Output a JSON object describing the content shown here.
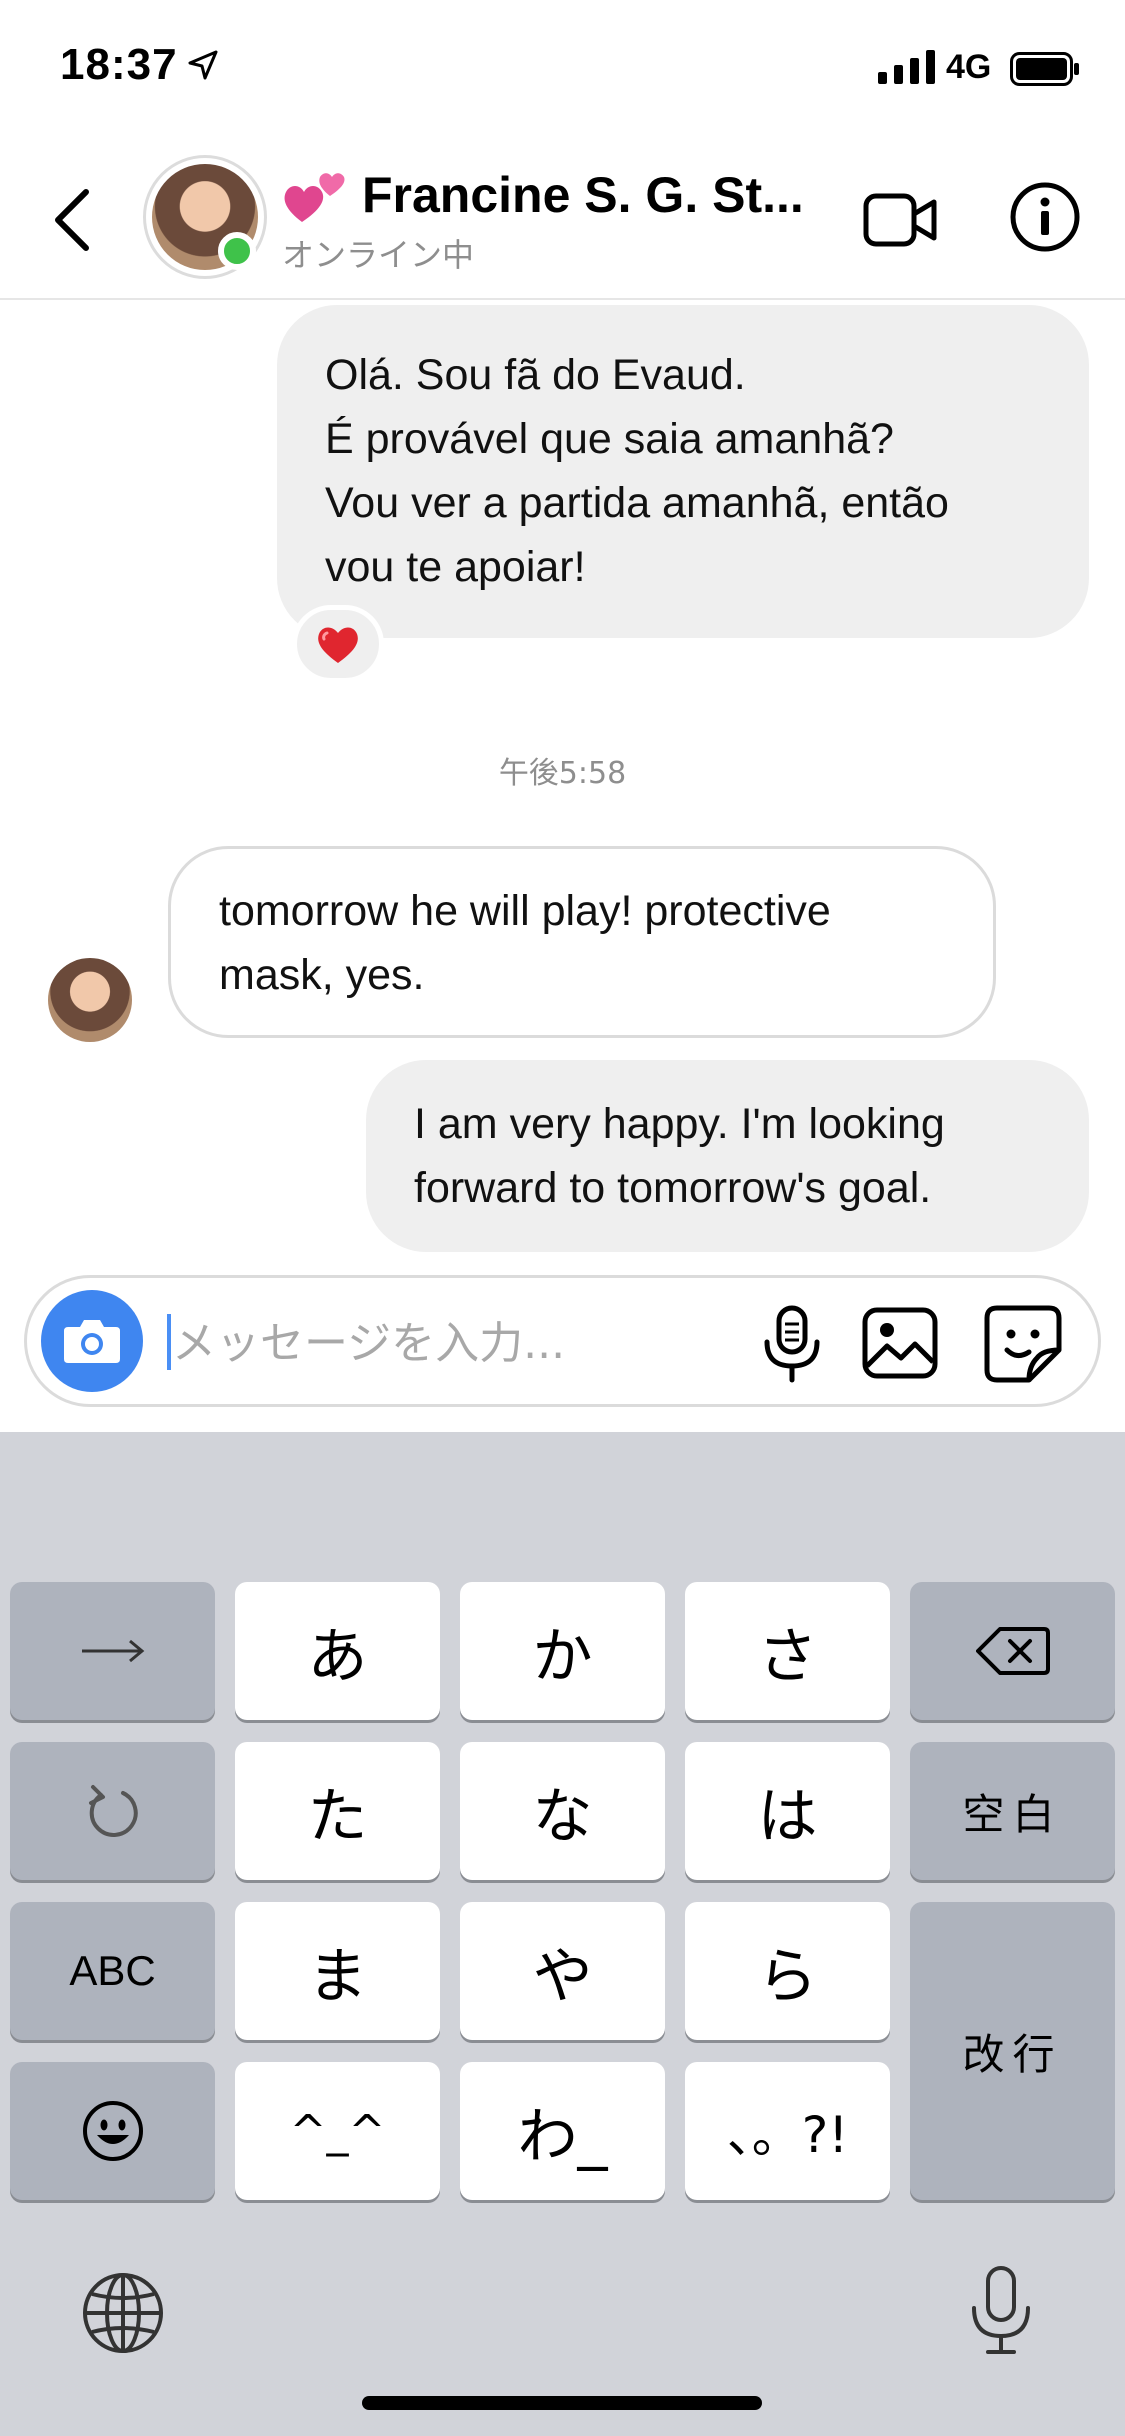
{
  "status_bar": {
    "time": "18:37",
    "network": "4G"
  },
  "header": {
    "contact_name": "Francine S. G. St...",
    "contact_status": "オンライン中",
    "hearts_emoji": "💕"
  },
  "messages": [
    {
      "direction": "outgoing",
      "text_lines": [
        "Olá. Sou fã do Evaud.",
        "É provável que saia amanhã?",
        "Vou ver a partida amanhã, então",
        "vou te apoiar!"
      ],
      "reaction": "❤️"
    },
    {
      "direction": "timestamp",
      "text": "午後5:58"
    },
    {
      "direction": "incoming",
      "text_lines": [
        "tomorrow he will play!  protective",
        "mask, yes."
      ]
    },
    {
      "direction": "outgoing",
      "text_lines": [
        "I am very happy.  I'm looking",
        "forward to tomorrow's goal."
      ]
    }
  ],
  "composer": {
    "placeholder": "メッセージを入力..."
  },
  "keyboard": {
    "row1": [
      "→",
      "あ",
      "か",
      "さ",
      "⌫"
    ],
    "row2": [
      "↺",
      "た",
      "な",
      "は",
      "空白"
    ],
    "row3": [
      "ABC",
      "ま",
      "や",
      "ら",
      "改行"
    ],
    "row4": [
      "☺",
      "^_^",
      "わ_",
      "、。?!"
    ]
  },
  "icons": {
    "back": "chevron-left-icon",
    "video": "video-call-icon",
    "info": "info-icon",
    "camera": "camera-icon",
    "mic": "microphone-icon",
    "gallery": "gallery-icon",
    "sticker": "sticker-icon",
    "globe": "globe-icon"
  },
  "colors": {
    "online": "#3fc24a",
    "camera_button": "#3f86f0",
    "bubble_gray": "#efefef",
    "keyboard_bg": "#d1d3d9"
  }
}
